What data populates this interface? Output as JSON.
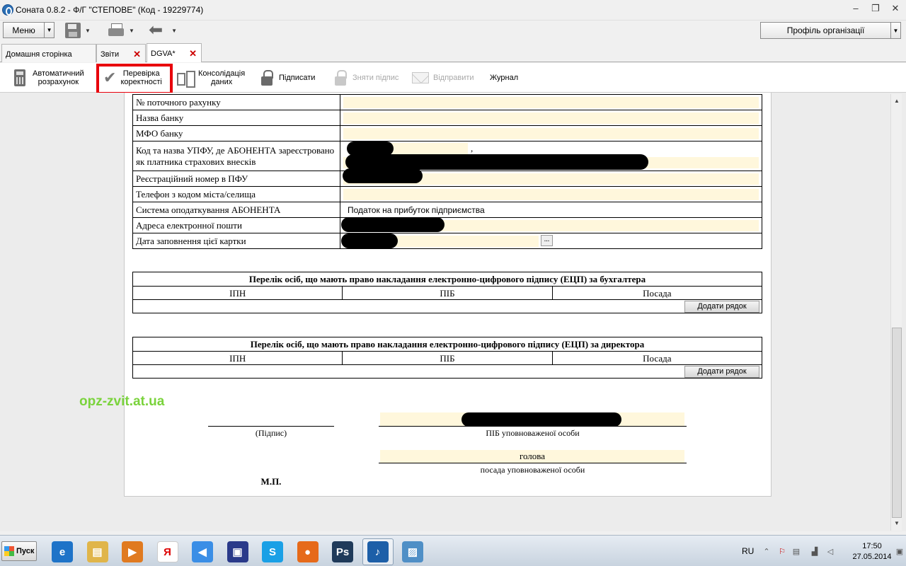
{
  "window": {
    "title": "Соната 0.8.2 - Ф/Г \"СТЕПОВЕ\" (Код - 19229774)",
    "controls": [
      "–",
      "❐",
      "✕"
    ]
  },
  "toolbar": {
    "menu_label": "Меню",
    "profile_label": "Профіль організації"
  },
  "tabs": [
    {
      "label": "Домашня сторінка",
      "closable": false
    },
    {
      "label": "Звіти",
      "closable": true
    },
    {
      "label": "DGVA*",
      "closable": true,
      "active": true
    }
  ],
  "actions": {
    "auto_calc": [
      "Автоматичний",
      "розрахунок"
    ],
    "check": [
      "Перевірка",
      "коректності"
    ],
    "consolidate": [
      "Консолідація",
      "даних"
    ],
    "sign": "Підписати",
    "unsign": "Зняти підпис",
    "send": "Відправити",
    "journal": "Журнал",
    "highlight_color": "#e8000b"
  },
  "form": {
    "rows": [
      {
        "label": "№ поточного рахунку",
        "value": ""
      },
      {
        "label": "Назва банку",
        "value": ""
      },
      {
        "label": "МФО банку",
        "value": ""
      },
      {
        "label": "Код та назва УПФУ, де АБОНЕНТА зареєстровано як платника страхових внесків",
        "value": ","
      },
      {
        "label": "Реєстраційний номер в ПФУ",
        "value": ""
      },
      {
        "label": "Телефон з кодом міста/селища",
        "value": ""
      },
      {
        "label": "Система оподаткування АБОНЕНТА",
        "value": "Податок на прибуток підприємства"
      },
      {
        "label": "Адреса електронної пошти",
        "value": ""
      },
      {
        "label": "Дата заповнення цієї картки",
        "value": ""
      }
    ],
    "date_picker_label": "..."
  },
  "sections": [
    {
      "title": "Перелік осіб, що мають право накладання електронно-цифрового підпису (ЕЦП) за бухгалтера",
      "columns": [
        "ІПН",
        "ПІБ",
        "Посада"
      ],
      "add_row": "Додати рядок"
    },
    {
      "title": "Перелік осіб, що мають право накладання електронно-цифрового підпису (ЕЦП) за директора",
      "columns": [
        "ІПН",
        "ПІБ",
        "Посада"
      ],
      "add_row": "Додати рядок"
    }
  ],
  "signature": {
    "watermark": "opz-zvit.at.ua",
    "signature_caption": "(Підпис)",
    "name_caption": "ПІБ уповноваженої особи",
    "position_value": "голова",
    "position_caption": "посада уповноваженої особи",
    "stamp": "М.П."
  },
  "colors": {
    "field_fill": "#fff7dc",
    "watermark": "#7ad33c",
    "close_x": "#cc0000"
  },
  "taskbar": {
    "start_label": "Пуск",
    "apps": [
      {
        "name": "internet-explorer",
        "glyph": "e",
        "color": "#1e73c8"
      },
      {
        "name": "file-explorer",
        "glyph": "▤",
        "color": "#e0b54a"
      },
      {
        "name": "media-player",
        "glyph": "▶",
        "color": "#e07a20"
      },
      {
        "name": "yandex-browser",
        "glyph": "Я",
        "color": "#ffffff"
      },
      {
        "name": "speaker-app",
        "glyph": "◀",
        "color": "#3a8ee6"
      },
      {
        "name": "save-disk-app",
        "glyph": "▣",
        "color": "#2a3a8a"
      },
      {
        "name": "skype",
        "glyph": "S",
        "color": "#1aa0e6"
      },
      {
        "name": "firefox",
        "glyph": "●",
        "color": "#e66a1a"
      },
      {
        "name": "photoshop",
        "glyph": "Ps",
        "color": "#1f3a5a"
      },
      {
        "name": "sonata-app",
        "glyph": "♪",
        "color": "#1d5fa8",
        "active": true
      },
      {
        "name": "image-viewer",
        "glyph": "▨",
        "color": "#4f8fc6"
      }
    ],
    "tray_lang": "RU",
    "clock_time": "17:50",
    "clock_date": "27.05.2014"
  }
}
